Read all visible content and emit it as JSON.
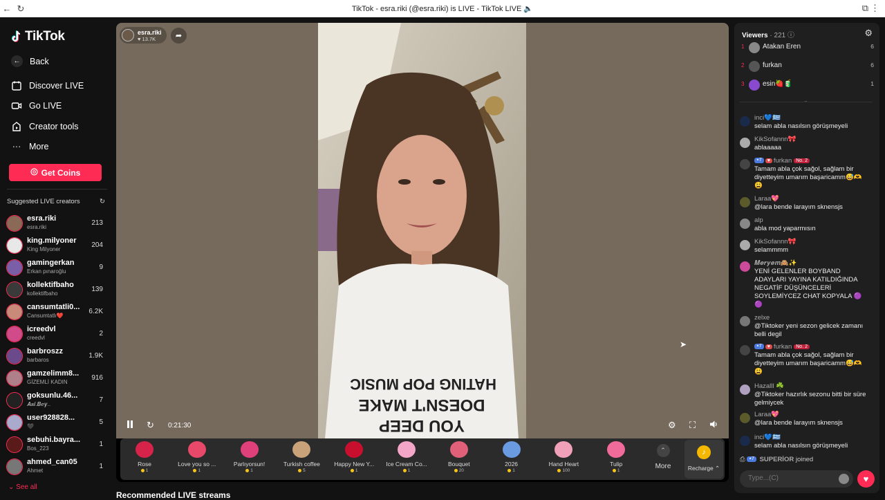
{
  "browser": {
    "title": "TikTok - esra.riki (@esra.riki) is LIVE - TikTok LIVE 🔈"
  },
  "brand": {
    "name": "TikTok"
  },
  "nav": {
    "back": "Back",
    "discover": "Discover LIVE",
    "go_live": "Go LIVE",
    "creator_tools": "Creator tools",
    "more": "More"
  },
  "get_coins": "Get Coins",
  "suggested": {
    "heading": "Suggested LIVE creators",
    "see_all": "See all",
    "creators": [
      {
        "name": "esra.riki",
        "sub": "esra.riki",
        "count": "213",
        "color": "#8a6a56"
      },
      {
        "name": "king.milyoner",
        "sub": "King Milyoner",
        "count": "204",
        "color": "#e8e8e8"
      },
      {
        "name": "gamingerkan",
        "sub": "Erkan pınaroğlu",
        "count": "9",
        "color": "#7a5fa8"
      },
      {
        "name": "kollektifbaho",
        "sub": "kollektifbaho",
        "count": "139",
        "color": "#3a3a3a"
      },
      {
        "name": "cansumtatli0...",
        "sub": "Cansumtatlı❤️",
        "count": "6.2K",
        "color": "#c98a7a"
      },
      {
        "name": "icreedvl",
        "sub": "creedvl",
        "count": "2",
        "color": "#d14a8a"
      },
      {
        "name": "barbroszz",
        "sub": "barbaros",
        "count": "1.9K",
        "color": "#6a4a8a"
      },
      {
        "name": "gamzelimm8...",
        "sub": "GİZEMLİ KADIN",
        "count": "916",
        "color": "#b0808a"
      },
      {
        "name": "goksunlu.46...",
        "sub": "𝑨𝒔𝒊.𝑩𝒆𝒚..",
        "count": "7",
        "color": "#222222"
      },
      {
        "name": "user928828...",
        "sub": "🖤",
        "count": "5",
        "color": "#aaaacc"
      },
      {
        "name": "sebuhi.bayra...",
        "sub": "Bos_223",
        "count": "1",
        "color": "#5a1a1a"
      },
      {
        "name": "ahmed_can05",
        "sub": "Ahmet",
        "count": "1",
        "color": "#777777"
      }
    ]
  },
  "stream": {
    "host_name": "esra.riki",
    "host_likes": "♥ 13.7K",
    "timer": "0:21:30",
    "icons": {
      "pause": "pause-icon",
      "refresh": "refresh-icon",
      "settings": "settings-icon",
      "fullscreen": "fullscreen-icon",
      "volume": "volume-icon"
    }
  },
  "gifts": [
    {
      "name": "Rose",
      "price": "1",
      "color": "#d6234a"
    },
    {
      "name": "Love you so ...",
      "price": "1",
      "color": "#e8486a"
    },
    {
      "name": "Parlıyorsun!",
      "price": "1",
      "color": "#e0407a"
    },
    {
      "name": "Turkish coffee",
      "price": "5",
      "color": "#c9a27a"
    },
    {
      "name": "Happy New Y...",
      "price": "1",
      "color": "#c8102e"
    },
    {
      "name": "Ice Cream Co...",
      "price": "1",
      "color": "#f4a6c8"
    },
    {
      "name": "Bouquet",
      "price": "20",
      "color": "#e0607a"
    },
    {
      "name": "2026",
      "price": "1",
      "color": "#6a9ae0"
    },
    {
      "name": "Hand Heart",
      "price": "100",
      "color": "#f0a0b8"
    },
    {
      "name": "Tulip",
      "price": "1",
      "color": "#f06a9a"
    }
  ],
  "gifts_more": "More",
  "recharge": "Recharge ⌃",
  "recommended_title": "Recommended LIVE streams",
  "viewers": {
    "title": "Viewers",
    "count": "· 221 ⓘ",
    "top": [
      {
        "rank": "1",
        "name": "Atakan Eren",
        "score": "6",
        "color": "#888888"
      },
      {
        "rank": "2",
        "name": "furkan",
        "score": "6",
        "color": "#555555"
      },
      {
        "rank": "3",
        "name": "esin🍓🧃",
        "score": "1",
        "color": "#8a4ad0"
      }
    ]
  },
  "chat": [
    {
      "user": "inci💙🇬🇷",
      "text": "selam abla nasılsın görüşmeyeli",
      "color": "#1a2a4a"
    },
    {
      "user": "KikSofannn🎀",
      "text": "ablaaaaa",
      "color": "#aaaaaa"
    },
    {
      "user": "furkan",
      "badge_lvl": "7",
      "badge_no": "No. 2",
      "text": "Tamam abla çok sağol, sağlam bir diyetteyim umarım başaricamm😅🫶 😩",
      "color": "#444444"
    },
    {
      "user": "Laraa💖",
      "text": "@lara bende larayım sknensjs",
      "color": "#5a5a2a"
    },
    {
      "user": "alp",
      "text": "abla mod yaparmısın",
      "color": "#888888"
    },
    {
      "user": "KikSofannn🎀",
      "text": "selammmm",
      "color": "#aaaaaa"
    },
    {
      "user": "𝑴𝒆𝒓𝒚𝒆𝒎🙈✨",
      "text": "YENİ GELENLER BOYBAND ADAYLARI YAYINA KATILDIĞINDA NEGATİF DÜŞÜNCELERİ SOYLEMİYCEZ CHAT KOPYALA 🟣 🟣",
      "color": "#cc4a9a"
    },
    {
      "user": "zelxe",
      "text": "@Tiktoker yeni sezon gelicek zamanı belli degil",
      "color": "#777777"
    },
    {
      "user": "furkan",
      "badge_lvl": "7",
      "badge_no": "No. 2",
      "text": "Tamam abla çok sağol, sağlam bir diyetteyim umarım başaricamm😅🫶 😩",
      "color": "#444444"
    },
    {
      "user": "Hazalll ☘️",
      "text": "@Tiktoker hazırlık sezonu bitti bir süre gelmiycek",
      "color": "#b0a0c0"
    },
    {
      "user": "Laraa💖",
      "text": "@lara bende larayım sknensjs",
      "color": "#5a5a2a"
    },
    {
      "user": "inci💙🇬🇷",
      "text": "selam abla nasılsın görüşmeyeli",
      "color": "#1a2a4a"
    }
  ],
  "joined": {
    "lvl": "7",
    "user": "SUPERİOR",
    "text": " joined"
  },
  "chat_input": {
    "placeholder": "Type...(C)"
  }
}
